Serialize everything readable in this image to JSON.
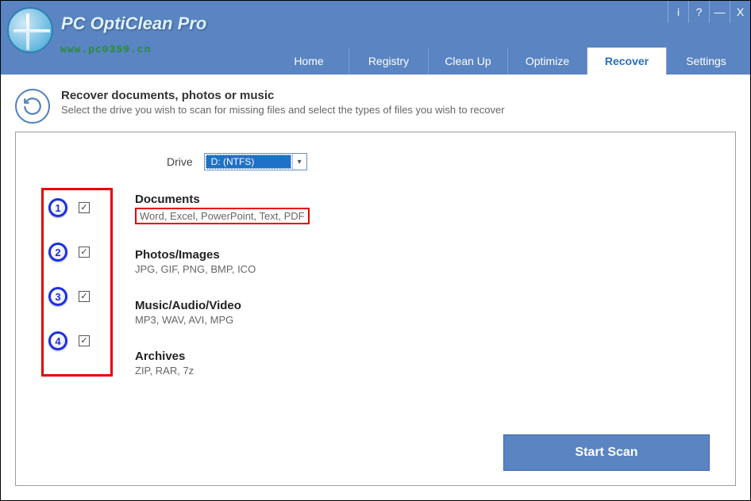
{
  "titlebar": {
    "info": "i",
    "help": "?",
    "min": "—",
    "close": "X"
  },
  "app": {
    "title": "PC OptiClean Pro",
    "watermark": "www.pc0359.cn"
  },
  "tabs": [
    {
      "id": "home",
      "label": "Home",
      "active": false
    },
    {
      "id": "registry",
      "label": "Registry",
      "active": false
    },
    {
      "id": "cleanup",
      "label": "Clean Up",
      "active": false
    },
    {
      "id": "optimize",
      "label": "Optimize",
      "active": false
    },
    {
      "id": "recover",
      "label": "Recover",
      "active": true
    },
    {
      "id": "settings",
      "label": "Settings",
      "active": false
    }
  ],
  "intro": {
    "title": "Recover documents, photos or music",
    "subtitle": "Select the drive you wish to scan for missing files and select the types of files you wish to recover"
  },
  "drive": {
    "label": "Drive",
    "selected": "D: (NTFS)"
  },
  "annotations": [
    "1",
    "2",
    "3",
    "4"
  ],
  "types": [
    {
      "key": "documents",
      "title": "Documents",
      "sub": "Word, Excel, PowerPoint, Text, PDF",
      "checked": true,
      "highlight": true
    },
    {
      "key": "photos",
      "title": "Photos/Images",
      "sub": "JPG, GIF, PNG, BMP, ICO",
      "checked": true,
      "highlight": false
    },
    {
      "key": "music",
      "title": "Music/Audio/Video",
      "sub": "MP3, WAV, AVI, MPG",
      "checked": true,
      "highlight": false
    },
    {
      "key": "archives",
      "title": "Archives",
      "sub": "ZIP, RAR, 7z",
      "checked": true,
      "highlight": false
    }
  ],
  "actions": {
    "start_scan": "Start Scan"
  }
}
